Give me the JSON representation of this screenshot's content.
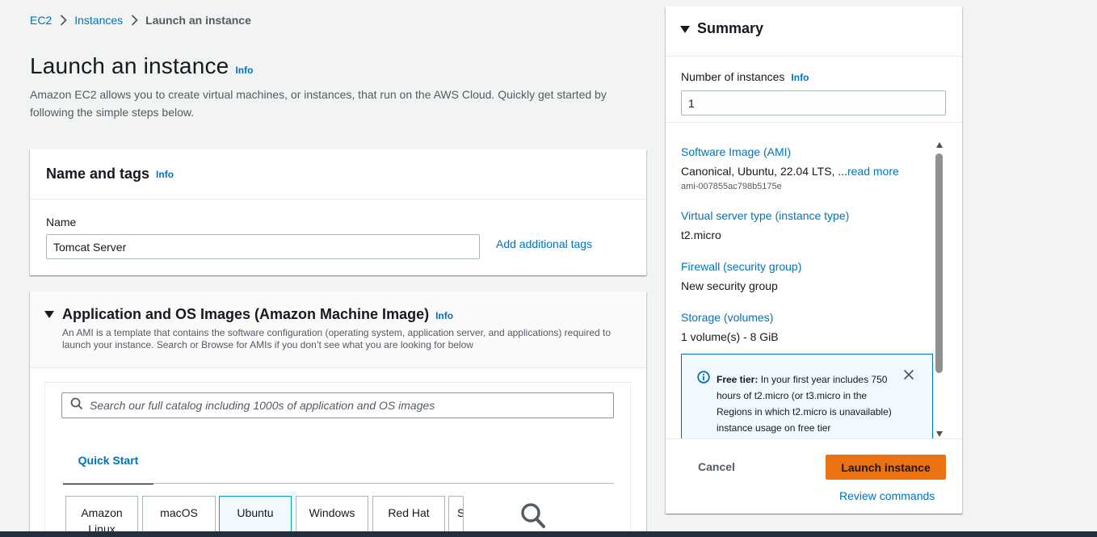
{
  "breadcrumb": {
    "items": [
      "EC2",
      "Instances"
    ],
    "current": "Launch an instance"
  },
  "page": {
    "title": "Launch an instance",
    "info": "Info",
    "description": "Amazon EC2 allows you to create virtual machines, or instances, that run on the AWS Cloud. Quickly get started by following the simple steps below."
  },
  "name_tags": {
    "title": "Name and tags",
    "info": "Info",
    "name_label": "Name",
    "name_value": "Tomcat Server",
    "add_tags": "Add additional tags"
  },
  "ami": {
    "title": "Application and OS Images (Amazon Machine Image)",
    "info": "Info",
    "description": "An AMI is a template that contains the software configuration (operating system, application server, and applications) required to launch your instance. Search or Browse for AMIs if you don’t see what you are looking for below",
    "search_placeholder": "Search our full catalog including 1000s of application and OS images",
    "tab": "Quick Start",
    "os_options": [
      "Amazon Linux",
      "macOS",
      "Ubuntu",
      "Windows",
      "Red Hat",
      "S"
    ],
    "selected": "Ubuntu"
  },
  "summary": {
    "title": "Summary",
    "num_label": "Number of instances",
    "info": "Info",
    "num_value": "1",
    "software_title": "Software Image (AMI)",
    "software_value": "Canonical, Ubuntu, 22.04 LTS, ...",
    "read_more": "read more",
    "ami_id": "ami-007855ac798b5175e",
    "server_title": "Virtual server type (instance type)",
    "server_value": "t2.micro",
    "firewall_title": "Firewall (security group)",
    "firewall_value": "New security group",
    "storage_title": "Storage (volumes)",
    "storage_value": "1 volume(s) - 8 GiB",
    "free_tier_label": "Free tier:",
    "free_tier_text": " In your first year includes 750 hours of t2.micro (or t3.micro in the Regions in which t2.micro is unavailable) instance usage on free tier",
    "cancel": "Cancel",
    "launch": "Launch instance",
    "review": "Review commands"
  },
  "colors": {
    "link": "#0073bb",
    "primary_button": "#ec7211",
    "selected_tile_bg": "#f1faff"
  }
}
